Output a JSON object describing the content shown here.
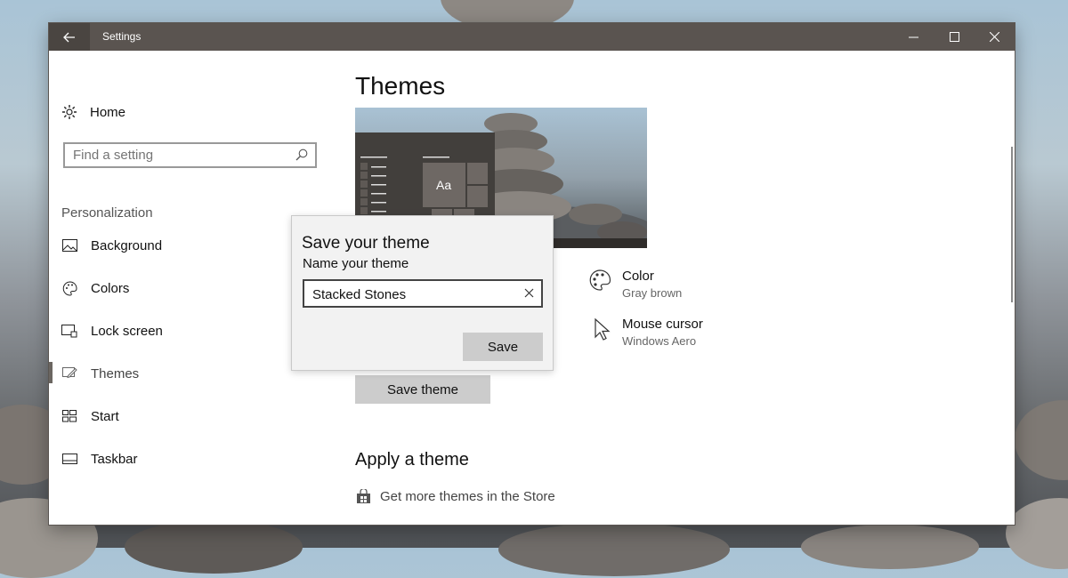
{
  "window": {
    "title": "Settings"
  },
  "sidebar": {
    "home_label": "Home",
    "search_placeholder": "Find a setting",
    "section_label": "Personalization",
    "items": [
      {
        "label": "Background",
        "icon": "picture-icon"
      },
      {
        "label": "Colors",
        "icon": "palette-icon"
      },
      {
        "label": "Lock screen",
        "icon": "lock-screen-icon"
      },
      {
        "label": "Themes",
        "icon": "brush-icon",
        "selected": true
      },
      {
        "label": "Start",
        "icon": "start-grid-icon"
      },
      {
        "label": "Taskbar",
        "icon": "taskbar-icon"
      }
    ]
  },
  "main": {
    "title": "Themes",
    "preview_tile_text": "Aa",
    "color": {
      "label": "Color",
      "value": "Gray brown"
    },
    "cursor": {
      "label": "Mouse cursor",
      "value": "Windows Aero"
    },
    "save_theme_button": "Save theme",
    "apply_title": "Apply a theme",
    "store_link": "Get more themes in the Store"
  },
  "dialog": {
    "title": "Save your theme",
    "label": "Name your theme",
    "input_value": "Stacked Stones",
    "save_button": "Save"
  },
  "colors": {
    "titlebar": "#5a5450",
    "accent": "#6b6661",
    "button_gray": "#cccccc"
  }
}
